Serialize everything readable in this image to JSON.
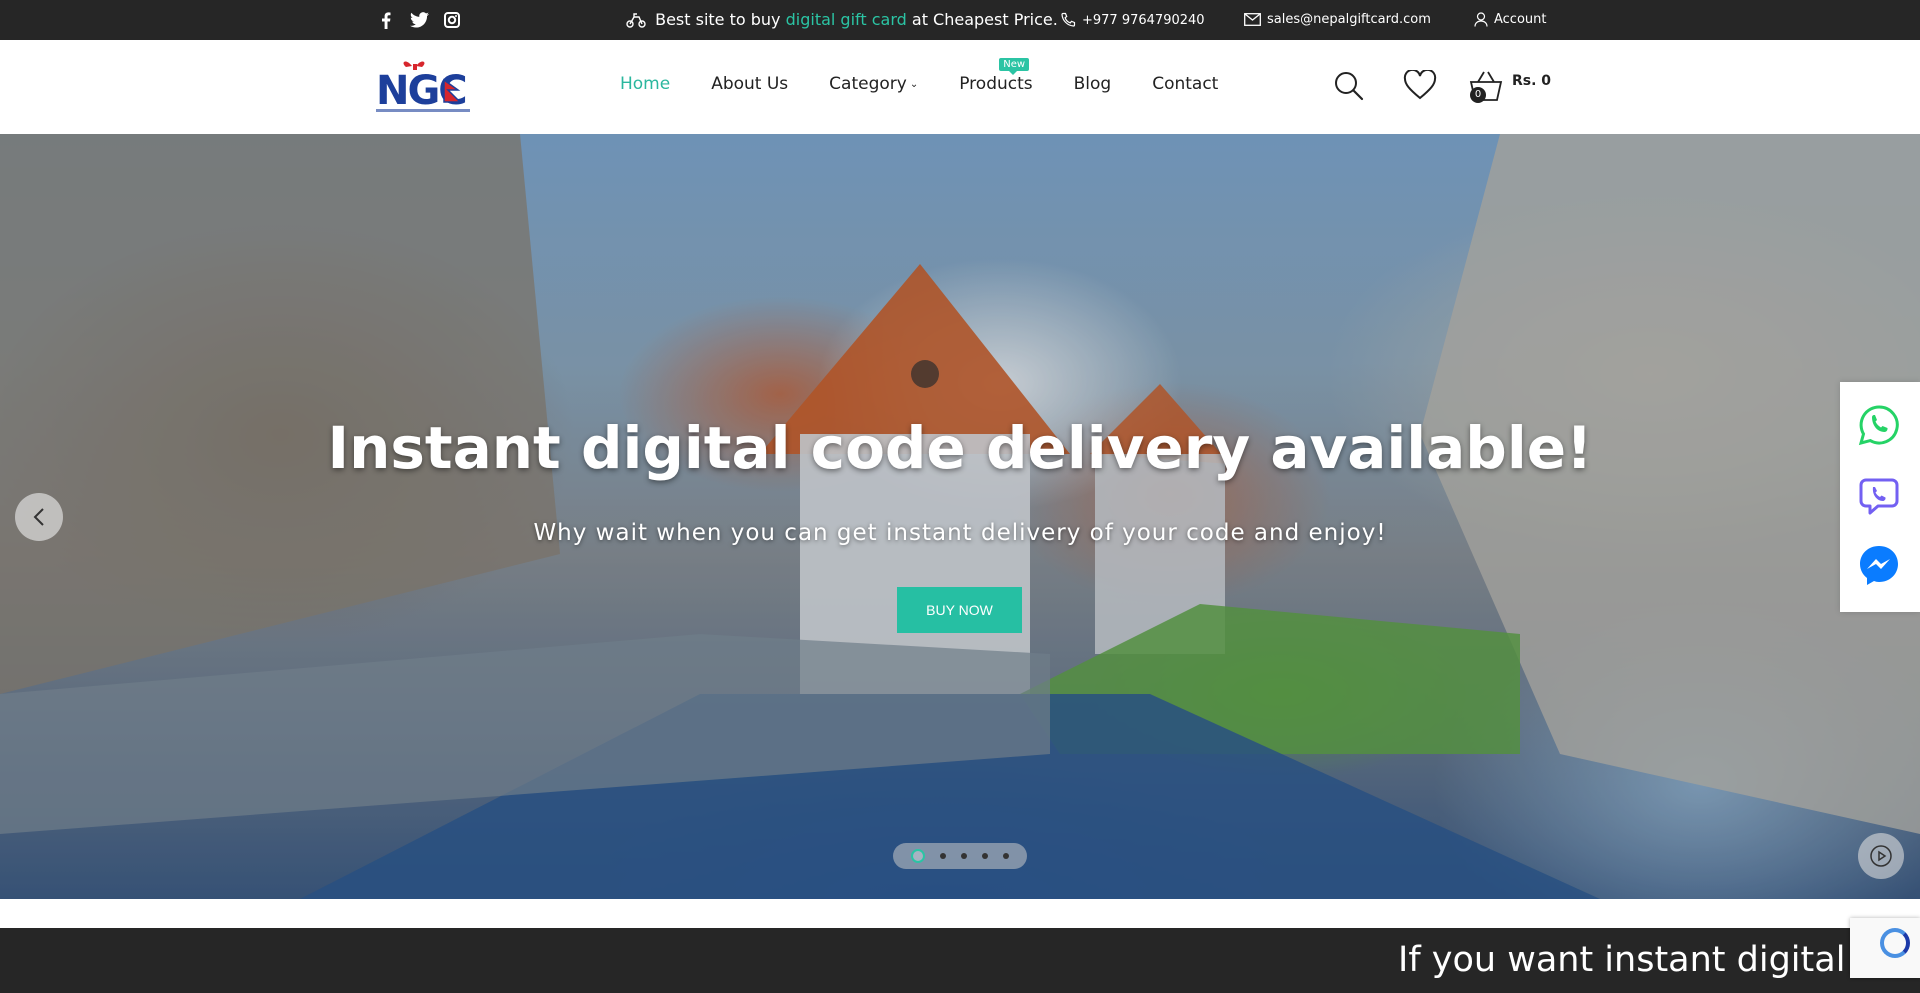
{
  "topbar": {
    "promo_prefix": "Best site to buy",
    "promo_accent": "digital gift card",
    "promo_suffix": "at Cheapest Price.",
    "phone": "+977 9764790240",
    "email": "sales@nepalgiftcard.com",
    "account": "Account",
    "social_icons": [
      "facebook-icon",
      "twitter-icon",
      "instagram-icon"
    ]
  },
  "header": {
    "logo_text": "NGC",
    "nav": [
      {
        "label": "Home"
      },
      {
        "label": "About Us"
      },
      {
        "label": "Category"
      },
      {
        "label": "Products",
        "badge": "New"
      },
      {
        "label": "Blog"
      },
      {
        "label": "Contact"
      }
    ],
    "cart_count": "0",
    "cart_total": "Rs. 0"
  },
  "hero": {
    "title": "Instant digital code delivery available!",
    "subtitle": "Why wait when you can get instant delivery of your code and enjoy!",
    "button": "BUY NOW",
    "slide_count": 5,
    "active_slide": 1
  },
  "chat_icons": [
    "whatsapp-icon",
    "viber-icon",
    "messenger-icon"
  ],
  "ticker": {
    "text": "If you want instant digital code, plea"
  },
  "colors": {
    "accent": "#2bc4a4",
    "dark": "#262626",
    "whatsapp": "#25d366",
    "viber": "#7360f2",
    "messenger": "#0a7cff"
  }
}
